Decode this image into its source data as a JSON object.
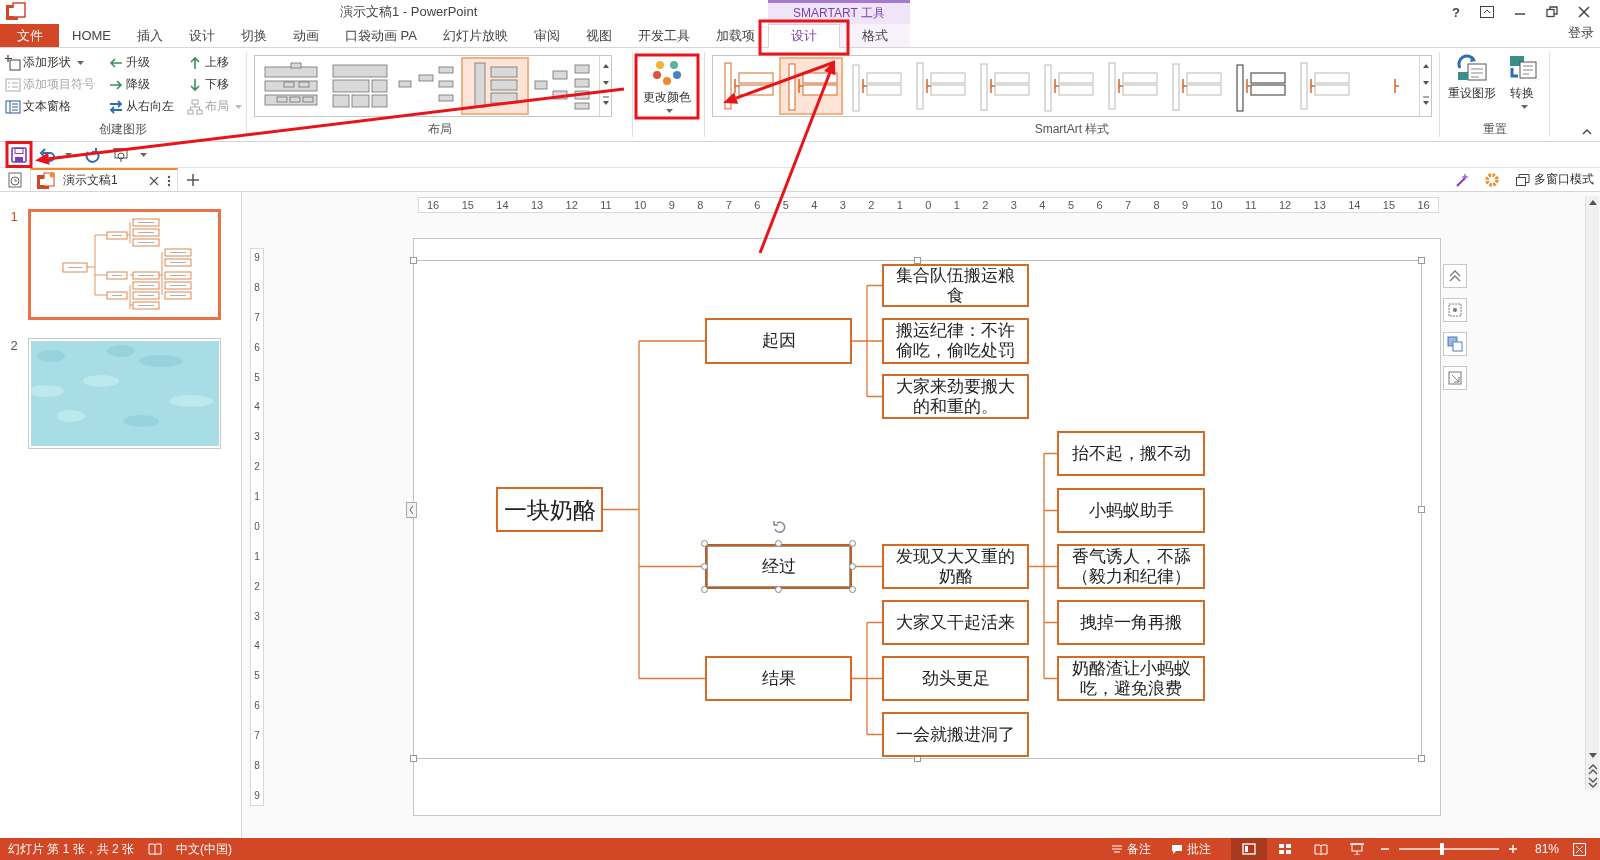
{
  "window": {
    "title": "演示文稿1 - PowerPoint",
    "context_tab_group": "SMARTART 工具",
    "help": "?",
    "sign_in": "登录"
  },
  "tabs": [
    {
      "label": "文件",
      "kind": "file",
      "selected": false
    },
    {
      "label": "HOME",
      "kind": "main",
      "selected": false
    },
    {
      "label": "插入",
      "kind": "main",
      "selected": false
    },
    {
      "label": "设计",
      "kind": "main",
      "selected": false
    },
    {
      "label": "切换",
      "kind": "main",
      "selected": false
    },
    {
      "label": "动画",
      "kind": "main",
      "selected": false
    },
    {
      "label": "口袋动画 PA",
      "kind": "main",
      "selected": false
    },
    {
      "label": "幻灯片放映",
      "kind": "main",
      "selected": false
    },
    {
      "label": "审阅",
      "kind": "main",
      "selected": false
    },
    {
      "label": "视图",
      "kind": "main",
      "selected": false
    },
    {
      "label": "开发工具",
      "kind": "main",
      "selected": false
    },
    {
      "label": "加载项",
      "kind": "main",
      "selected": false
    },
    {
      "label": "设计",
      "kind": "context",
      "selected": true
    },
    {
      "label": "格式",
      "kind": "context",
      "selected": false
    }
  ],
  "ribbon": {
    "create": {
      "label": "创建图形",
      "buttons": [
        {
          "label": "添加形状",
          "kind": "add_shape",
          "dropdown": true,
          "disabled": false
        },
        {
          "label": "添加项目符号",
          "kind": "add_bullet",
          "dropdown": false,
          "disabled": true
        },
        {
          "label": "文本窗格",
          "kind": "text_pane",
          "dropdown": false,
          "disabled": false
        },
        {
          "label": "升级",
          "kind": "promote",
          "dropdown": false,
          "disabled": false
        },
        {
          "label": "降级",
          "kind": "demote",
          "dropdown": false,
          "disabled": false
        },
        {
          "label": "从右向左",
          "kind": "right_to_left",
          "dropdown": false,
          "disabled": false
        },
        {
          "label": "上移",
          "kind": "move_up",
          "dropdown": false,
          "disabled": false
        },
        {
          "label": "下移",
          "kind": "move_down",
          "dropdown": false,
          "disabled": false
        },
        {
          "label": "布局",
          "kind": "layout",
          "dropdown": true,
          "disabled": true
        }
      ]
    },
    "layouts": {
      "label": "布局",
      "items": [
        {
          "selected": false
        },
        {
          "selected": false
        },
        {
          "selected": false
        },
        {
          "selected": true
        },
        {
          "selected": false
        }
      ]
    },
    "colors": {
      "label": "更改颜色"
    },
    "styles": {
      "label": "SmartArt 样式",
      "items": [
        {
          "selected": false
        },
        {
          "selected": true
        },
        {
          "selected": false
        },
        {
          "selected": false
        },
        {
          "selected": false
        },
        {
          "selected": false
        },
        {
          "selected": false
        },
        {
          "selected": false
        },
        {
          "selected": false
        },
        {
          "selected": false
        },
        {
          "selected": false
        }
      ]
    },
    "reset": {
      "label": "重置",
      "buttons": [
        {
          "label": "重设图形",
          "kind": "reset",
          "dropdown": false
        },
        {
          "label": "转换",
          "kind": "convert",
          "dropdown": true
        }
      ]
    }
  },
  "document_tabs": [
    {
      "title": "演示文稿1",
      "selected": true
    }
  ],
  "window_mode": "多窗口模式",
  "slides": [
    {
      "number": "1",
      "kind": "diagram",
      "selected": true
    },
    {
      "number": "2",
      "kind": "picture",
      "selected": false
    }
  ],
  "rulers": {
    "horizontal": [
      "16",
      "15",
      "14",
      "13",
      "12",
      "11",
      "10",
      "9",
      "8",
      "7",
      "6",
      "5",
      "4",
      "3",
      "2",
      "1",
      "0",
      "1",
      "2",
      "3",
      "4",
      "5",
      "6",
      "7",
      "8",
      "9",
      "10",
      "11",
      "12",
      "13",
      "14",
      "15",
      "16"
    ],
    "vertical": [
      "9",
      "8",
      "7",
      "6",
      "5",
      "4",
      "3",
      "2",
      "1",
      "0",
      "1",
      "2",
      "3",
      "4",
      "5",
      "6",
      "7",
      "8",
      "9"
    ]
  },
  "diagram": {
    "root": {
      "text": "一块奶酪",
      "selected": false,
      "children": [
        {
          "text": "起因",
          "selected": false,
          "children": [
            {
              "text": "集合队伍搬运粮食",
              "selected": false
            },
            {
              "text": "搬运纪律：不许偷吃，偷吃处罚",
              "selected": false
            },
            {
              "text": "大家来劲要搬大的和重的。",
              "selected": false
            }
          ]
        },
        {
          "text": "经过",
          "selected": true,
          "children": [
            {
              "text": "发现又大又重的奶酪",
              "selected": false,
              "children": [
                {
                  "text": "抬不起，搬不动",
                  "selected": false
                },
                {
                  "text": "小蚂蚁助手",
                  "selected": false
                },
                {
                  "text": "香气诱人，不舔（毅力和纪律）",
                  "selected": false
                },
                {
                  "text": "拽掉一角再搬",
                  "selected": false
                },
                {
                  "text": "奶酪渣让小蚂蚁吃，避免浪费",
                  "selected": false
                }
              ]
            }
          ]
        },
        {
          "text": "结果",
          "selected": false,
          "children": [
            {
              "text": "大家又干起活来",
              "selected": false
            },
            {
              "text": "劲头更足",
              "selected": false
            },
            {
              "text": "一会就搬进洞了",
              "selected": false
            }
          ]
        }
      ]
    }
  },
  "status_bar": {
    "slide_info": "幻灯片 第 1 张，共 2 张",
    "language": "中文(中国)",
    "notes": "备注",
    "comments": "批注",
    "views": [
      {
        "kind": "normal",
        "selected": true
      },
      {
        "kind": "sorter",
        "selected": false
      },
      {
        "kind": "reading",
        "selected": false
      },
      {
        "kind": "slideshow",
        "selected": false
      }
    ],
    "zoom_slider": {
      "level": 0.41
    },
    "zoom": "81%"
  },
  "annotations": [
    {
      "kind": "box"
    },
    {
      "kind": "box"
    },
    {
      "kind": "box"
    },
    {
      "kind": "arrow"
    },
    {
      "kind": "arrow"
    },
    {
      "kind": "arrow"
    }
  ]
}
